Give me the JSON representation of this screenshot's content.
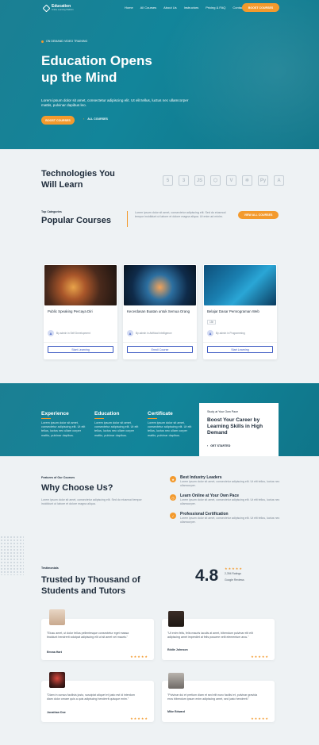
{
  "header": {
    "logo_title": "Education",
    "logo_sub": "Online Learning Platform",
    "nav": [
      "Home",
      "All Courses",
      "About Us",
      "Instructors",
      "Pricing & FAQ",
      "Contact"
    ],
    "cta": "Boost Courses"
  },
  "hero": {
    "tag": "On Demand Video Training",
    "title_line1": "Education Opens",
    "title_line2": "up the Mind",
    "description": "Lorem ipsum dolor sit amet, consectetur adipiscing elit. Ut elit tellus, luctus nec ullamcorper mattis, pulvinar dapibus leo.",
    "primary_button": "Boost Courses",
    "secondary_link": "All Courses"
  },
  "technologies": {
    "title_line1": "Technologies You",
    "title_line2": "Will Learn",
    "icons": [
      "html5-icon",
      "css3-icon",
      "javascript-icon",
      "nodejs-icon",
      "vuejs-icon",
      "react-icon",
      "python-icon",
      "angular-icon"
    ],
    "icon_glyphs": [
      "5",
      "3",
      "JS",
      "⬡",
      "V",
      "⚛",
      "Py",
      "A"
    ]
  },
  "popular": {
    "label": "Top Categories",
    "title": "Popular Courses",
    "description": "Lorem ipsum dolor sit amet, consectetur adipiscing elit. Sed do eiusmod tempor incididunt ut labore et dolore magna aliqua. Ut enim ad minim.",
    "button": "View All Courses"
  },
  "courses": [
    {
      "title": "Public Speaking Percaya Diri",
      "author": "By admin in Self Development",
      "button": "Start Learning"
    },
    {
      "title": "Kecerdasan Buatan untuk Semua Orang",
      "author": "By admin in Artificial Intelligence",
      "button": "Enroll Course"
    },
    {
      "title": "Belajar Dasar Pemrograman Web",
      "badge": "15h",
      "author": "By admin in Programming",
      "button": "Start Learning"
    }
  ],
  "features": [
    {
      "title": "Experience",
      "text": "Lorem ipsum dolor sit amet, consectetur adipiscing elit. Ut elit tellus, luctus nec ullam corper mattis, pulvinar dapibus."
    },
    {
      "title": "Education",
      "text": "Lorem ipsum dolor sit amet, consectetur adipiscing elit. Ut elit tellus, luctus nec ullam corper mattis, pulvinar dapibus."
    },
    {
      "title": "Certificate",
      "text": "Lorem ipsum dolor sit amet, consectetur adipiscing elit. Ut elit tellus, luctus nec ullam corper mattis, pulvinar dapibus."
    }
  ],
  "career": {
    "label": "Study at Your Own Pace",
    "title": "Boost Your Career by Learning Skills in High Demand",
    "link": "Get Started"
  },
  "why": {
    "label": "Features of Our Courses",
    "title": "Why Choose Us?",
    "description": "Lorem ipsum dolor sit amet, consectetur adipiscing elit. Sed do eiusmod tempor incididunt ut labore et dolore magna aliqua.",
    "items": [
      {
        "title": "Best Industry Leaders",
        "text": "Lorem ipsum dolor sit amet, consectetur adipiscing elit. Ut elit tellus, luctus nec ullamcorper."
      },
      {
        "title": "Learn Online at Your Own Pace",
        "text": "Lorem ipsum dolor sit amet, consectetur adipiscing elit. Ut elit tellus, luctus nec ullamcorper."
      },
      {
        "title": "Professional Certification",
        "text": "Lorem ipsum dolor sit amet, consectetur adipiscing elit. Ut elit tellus, luctus nec ullamcorper."
      }
    ]
  },
  "testimonials": {
    "label": "Testimonials",
    "title_line1": "Trusted by Thousand of",
    "title_line2": "Students and Tutors",
    "rating": "4.8",
    "rating_count": "2,394 Ratings",
    "rating_source": "Google Reviews",
    "stars": "★★★★★",
    "items": [
      {
        "text": "\"Eiusu amet, ut dolor tellus pellentesque consectetur eget massa tincidunt hendrerit volutpat adipiscing elit ut sit amet vel mauris.\"",
        "name": "Emma Hart"
      },
      {
        "text": "\"Ut enim felis, felis mauris iaculis at amet, bibendum pulvinar elit elit adipiscing amet imperdiet at felis posuere velit elementum arcu.\"",
        "name": "Eddie Johnson"
      },
      {
        "text": "\"Diam in cursus facilisis justo, suscipiat aliquet et justo est id interdum diam dolor ornare quis a quis adipiscing hendrerit quisque enim.\"",
        "name": "Jonathan Doe"
      },
      {
        "text": "\"Pulvinar dui et pretium diam et sed elit nunc facilisi et, pulvinar gravida eros bibendum ipsum enim adipiscing amet, sed justo hendrerit.\"",
        "name": "Mike Edward"
      }
    ]
  },
  "colors": {
    "teal": "#12859a",
    "orange": "#f39a2d",
    "blue": "#3a58c2",
    "dark": "#1d2b3a"
  }
}
